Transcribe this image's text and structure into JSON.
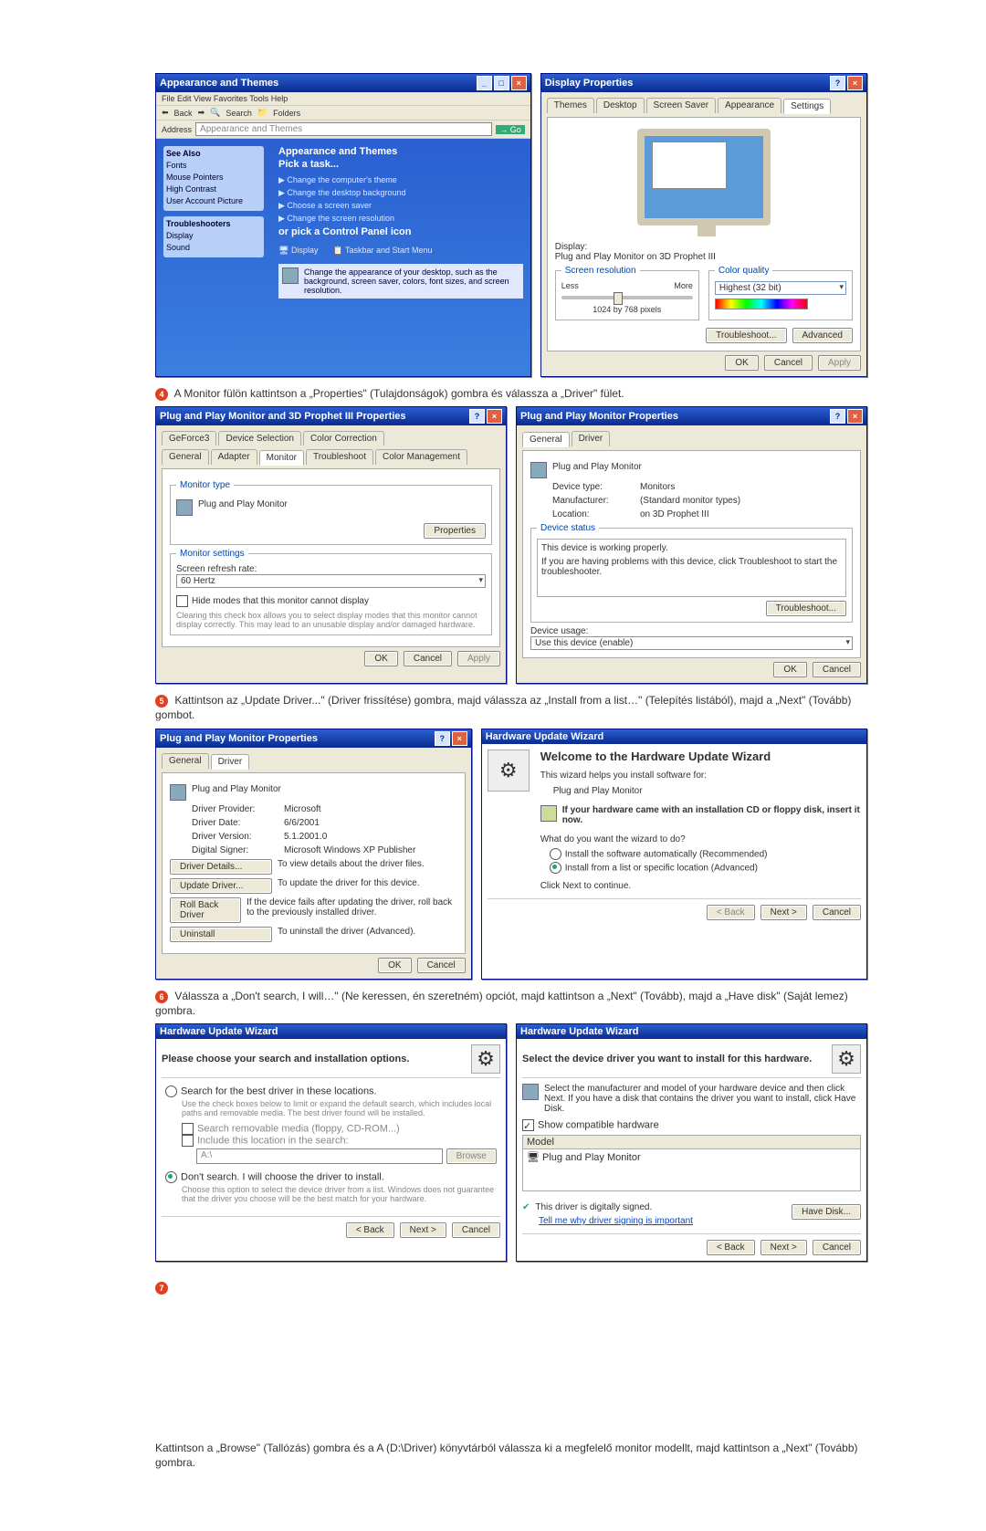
{
  "step4": {
    "number": "4",
    "text": "A Monitor fülön kattintson a „Properties\" (Tulajdonságok) gombra és válassza a „Driver\" fület."
  },
  "step5": {
    "number": "5",
    "text": "Kattintson az „Update Driver...\" (Driver frissítése) gombra, majd válassza az „Install from a list…\" (Telepítés listából), majd a „Next\" (Tovább) gombot."
  },
  "step6": {
    "number": "6",
    "text": "Válassza a „Don't search, I will…\" (Ne keressen, én szeretném) opciót, majd kattintson a „Next\" (Tovább), majd a „Have disk\" (Saját lemez) gombra."
  },
  "step7": {
    "number": "7",
    "text": "Kattintson a „Browse\" (Tallózás) gombra és a A (D:\\Driver) könyvtárból válassza ki a megfelelő monitor modellt, majd kattintson a „Next\" (Tovább) gombra."
  },
  "cpl": {
    "title": "Appearance and Themes",
    "toolbar_back": "Back",
    "toolbar_search": "Search",
    "toolbar_folders": "Folders",
    "address_label": "Address",
    "address_value": "Appearance and Themes",
    "see_also": "See Also",
    "see_items": [
      "Fonts",
      "Mouse Pointers",
      "High Contrast",
      "User Account Picture"
    ],
    "troubleshooters": "Troubleshooters",
    "ts_items": [
      "Display",
      "Sound"
    ],
    "heading": "Appearance and Themes",
    "pick_task": "Pick a task...",
    "tasks": [
      "Change the computer's theme",
      "Change the desktop background",
      "Choose a screen saver",
      "Change the screen resolution"
    ],
    "or_pick": "or pick a Control Panel icon",
    "icons": [
      "Display",
      "Taskbar and Start Menu"
    ],
    "footer_text": "Change the appearance of your desktop, such as the background, screen saver, colors, font sizes, and screen resolution."
  },
  "display_props": {
    "title": "Display Properties",
    "tabs": [
      "Themes",
      "Desktop",
      "Screen Saver",
      "Appearance",
      "Settings"
    ],
    "display_label": "Display:",
    "display_value": "Plug and Play Monitor on 3D Prophet III",
    "res_legend": "Screen resolution",
    "res_less": "Less",
    "res_more": "More",
    "res_value": "1024 by 768 pixels",
    "cq_legend": "Color quality",
    "cq_value": "Highest (32 bit)",
    "troubleshoot": "Troubleshoot...",
    "advanced": "Advanced",
    "ok": "OK",
    "cancel": "Cancel",
    "apply": "Apply"
  },
  "adv": {
    "title": "Plug and Play Monitor and 3D Prophet III Properties",
    "tabs_top": [
      "GeForce3",
      "Device Selection",
      "Color Correction"
    ],
    "tabs_bot": [
      "General",
      "Adapter",
      "Monitor",
      "Troubleshoot",
      "Color Management"
    ],
    "mt_legend": "Monitor type",
    "mt_value": "Plug and Play Monitor",
    "properties": "Properties",
    "ms_legend": "Monitor settings",
    "refresh_label": "Screen refresh rate:",
    "refresh_value": "60 Hertz",
    "hide_cb": "Hide modes that this monitor cannot display",
    "hide_text": "Clearing this check box allows you to select display modes that this monitor cannot display correctly. This may lead to an unusable display and/or damaged hardware.",
    "ok": "OK",
    "cancel": "Cancel",
    "apply": "Apply"
  },
  "monprops": {
    "title": "Plug and Play Monitor Properties",
    "tabs": [
      "General",
      "Driver"
    ],
    "name": "Plug and Play Monitor",
    "dt_label": "Device type:",
    "dt_value": "Monitors",
    "mf_label": "Manufacturer:",
    "mf_value": "(Standard monitor types)",
    "loc_label": "Location:",
    "loc_value": "on 3D Prophet III",
    "status_legend": "Device status",
    "status_text": "This device is working properly.",
    "status_help": "If you are having problems with this device, click Troubleshoot to start the troubleshooter.",
    "troubleshoot": "Troubleshoot...",
    "usage_label": "Device usage:",
    "usage_value": "Use this device (enable)",
    "ok": "OK",
    "cancel": "Cancel"
  },
  "driver": {
    "title": "Plug and Play Monitor Properties",
    "tabs": [
      "General",
      "Driver"
    ],
    "name": "Plug and Play Monitor",
    "provider_label": "Driver Provider:",
    "provider_value": "Microsoft",
    "date_label": "Driver Date:",
    "date_value": "6/6/2001",
    "version_label": "Driver Version:",
    "version_value": "5.1.2001.0",
    "signer_label": "Digital Signer:",
    "signer_value": "Microsoft Windows XP Publisher",
    "details_btn": "Driver Details...",
    "details_txt": "To view details about the driver files.",
    "update_btn": "Update Driver...",
    "update_txt": "To update the driver for this device.",
    "rollback_btn": "Roll Back Driver",
    "rollback_txt": "If the device fails after updating the driver, roll back to the previously installed driver.",
    "uninstall_btn": "Uninstall",
    "uninstall_txt": "To uninstall the driver (Advanced).",
    "ok": "OK",
    "cancel": "Cancel"
  },
  "wiz1": {
    "title": "Hardware Update Wizard",
    "heading": "Welcome to the Hardware Update Wizard",
    "intro": "This wizard helps you install software for:",
    "device": "Plug and Play Monitor",
    "cd_text": "If your hardware came with an installation CD or floppy disk, insert it now.",
    "question": "What do you want the wizard to do?",
    "opt1": "Install the software automatically (Recommended)",
    "opt2": "Install from a list or specific location (Advanced)",
    "next_hint": "Click Next to continue.",
    "back": "< Back",
    "next": "Next >",
    "cancel": "Cancel"
  },
  "wiz2": {
    "title": "Hardware Update Wizard",
    "heading": "Please choose your search and installation options.",
    "opt_search": "Search for the best driver in these locations.",
    "opt_search_txt": "Use the check boxes below to limit or expand the default search, which includes local paths and removable media. The best driver found will be installed.",
    "cb1": "Search removable media (floppy, CD-ROM...)",
    "cb2": "Include this location in the search:",
    "path": "A:\\",
    "browse": "Browse",
    "opt_dont": "Don't search. I will choose the driver to install.",
    "opt_dont_txt": "Choose this option to select the device driver from a list. Windows does not guarantee that the driver you choose will be the best match for your hardware.",
    "back": "< Back",
    "next": "Next >",
    "cancel": "Cancel"
  },
  "wiz3": {
    "title": "Hardware Update Wizard",
    "heading": "Select the device driver you want to install for this hardware.",
    "help": "Select the manufacturer and model of your hardware device and then click Next. If you have a disk that contains the driver you want to install, click Have Disk.",
    "show_compat": "Show compatible hardware",
    "model_label": "Model",
    "model_value": "Plug and Play Monitor",
    "signed": "This driver is digitally signed.",
    "tell_me": "Tell me why driver signing is important",
    "have_disk": "Have Disk...",
    "back": "< Back",
    "next": "Next >",
    "cancel": "Cancel"
  }
}
